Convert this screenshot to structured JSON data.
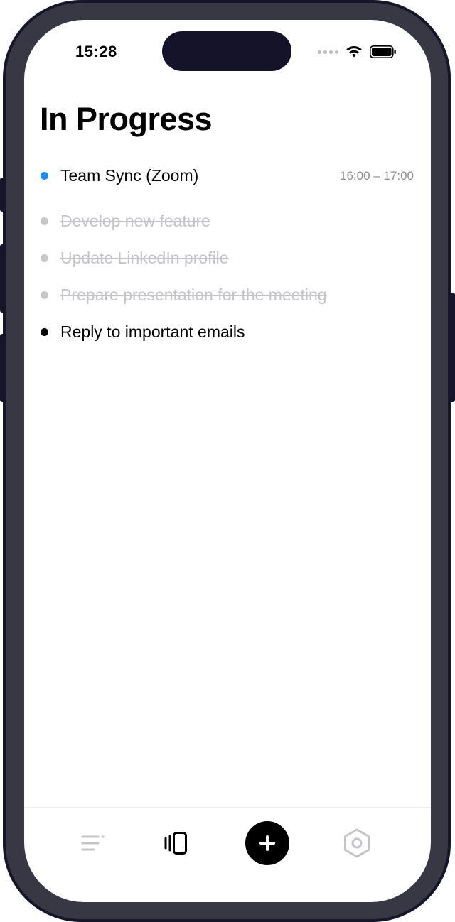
{
  "status_bar": {
    "time": "15:28"
  },
  "header": {
    "title": "In Progress"
  },
  "tasks": [
    {
      "label": "Team Sync (Zoom)",
      "time": "16:00 – 17:00",
      "state": "event",
      "dot_color": "#1a8cf0"
    },
    {
      "label": "Develop new feature",
      "state": "done",
      "dot_color": "#c8c8cc"
    },
    {
      "label": "Update LinkedIn profile",
      "state": "done",
      "dot_color": "#c8c8cc"
    },
    {
      "label": "Prepare presentation for the meeting",
      "state": "done",
      "dot_color": "#c8c8cc"
    },
    {
      "label": "Reply to important emails",
      "state": "active",
      "dot_color": "#000000"
    }
  ],
  "tab_bar": {
    "items": [
      {
        "icon": "list-icon",
        "active": false
      },
      {
        "icon": "cards-icon",
        "active": true
      },
      {
        "icon": "add-icon",
        "active": false
      },
      {
        "icon": "settings-hexagon-icon",
        "active": false
      }
    ]
  },
  "colors": {
    "accent": "#1a8cf0",
    "done": "#c4c4c8",
    "inactive_icon": "#c4c4c8",
    "frame": "#383845"
  }
}
